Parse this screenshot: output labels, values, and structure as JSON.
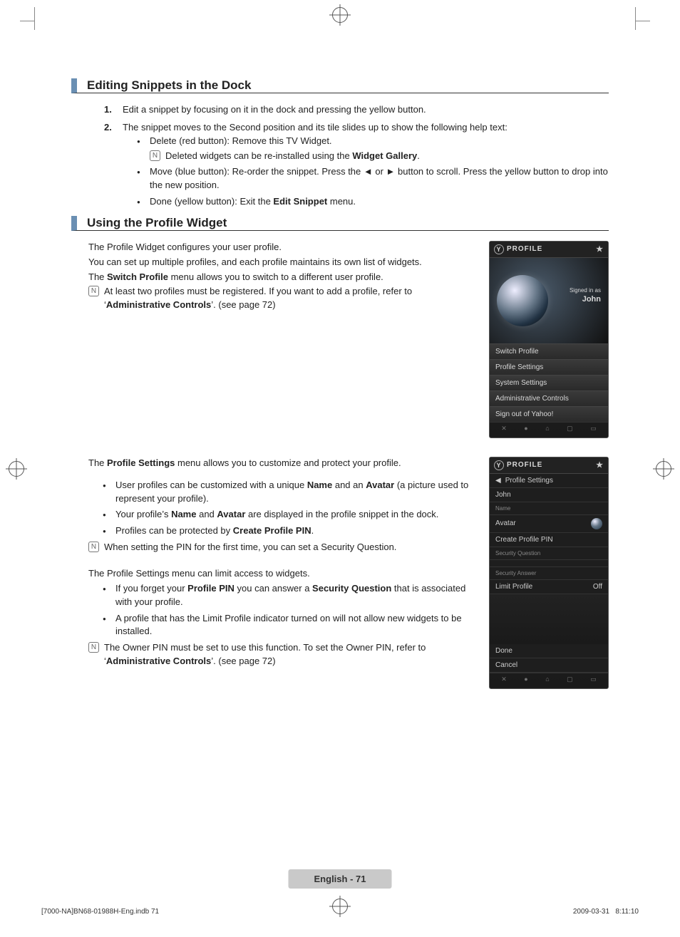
{
  "section1": {
    "title": "Editing Snippets in the Dock",
    "step1": "Edit a snippet by focusing on it in the dock and pressing the yellow button.",
    "step2": "The snippet moves to the Second position and its tile slides up to show the following help text:",
    "bullets": {
      "b1": "Delete (red button): Remove this TV Widget.",
      "b1_note_pre": "Deleted widgets can be re-installed using the ",
      "b1_note_bold": "Widget Gallery",
      "b1_note_post": ".",
      "b2": "Move (blue button): Re-order the snippet. Press the ◄ or ► button to scroll. Press the yellow button to drop into the new position.",
      "b3_pre": "Done (yellow button): Exit the ",
      "b3_bold": "Edit Snippet",
      "b3_post": " menu."
    }
  },
  "section2": {
    "title": "Using the Profile Widget",
    "p1": "The Profile Widget configures your user profile.",
    "p2": "You can set up multiple profiles, and each profile maintains its own list of widgets.",
    "p3_pre": "The ",
    "p3_bold": "Switch Profile",
    "p3_post": " menu allows you to switch to a different user profile.",
    "note_pre": "At least two profiles must be registered. If you want to add a profile, refer to ‘",
    "note_bold": "Administrative Controls",
    "note_post": "’. (see page 72)",
    "p4_pre": "The ",
    "p4_bold": "Profile Settings",
    "p4_post": " menu allows you to customize and protect your profile.",
    "s2b": {
      "b1_pre": "User profiles can be customized with a unique ",
      "b1_bold1": "Name",
      "b1_mid": " and an ",
      "b1_bold2": "Avatar",
      "b1_post": " (a picture used to represent your profile).",
      "b2_pre": "Your profile’s ",
      "b2_bold1": "Name",
      "b2_mid": " and ",
      "b2_bold2": "Avatar",
      "b2_post": " are displayed in the profile snippet in the dock.",
      "b3_pre": "Profiles can be protected by ",
      "b3_bold": "Create Profile PIN",
      "b3_post": ".",
      "note2": "When setting the PIN for the first time, you can set a Security Question."
    },
    "p5": "The Profile Settings menu can limit access to widgets.",
    "s2c": {
      "b1_pre": "If you forget your ",
      "b1_bold1": "Profile PIN",
      "b1_mid": " you can answer a ",
      "b1_bold2": "Security Question",
      "b1_post": " that is associated with your profile.",
      "b2": "A profile that has the Limit Profile indicator turned on will not allow new widgets to be installed.",
      "note3_pre": "The Owner PIN must be set to use this function. To set the Owner PIN, refer to ‘",
      "note3_bold": "Administrative Controls",
      "note3_post": "’. (see page 72)"
    }
  },
  "widget1": {
    "title": "PROFILE",
    "signed_label": "Signed in as",
    "signed_name": "John",
    "items": [
      "Switch Profile",
      "Profile Settings",
      "System Settings",
      "Administrative Controls",
      "Sign out of Yahoo!"
    ]
  },
  "widget2": {
    "title": "PROFILE",
    "back_label": "Profile Settings",
    "name_label": "John",
    "name_field": "Name",
    "avatar_label": "Avatar",
    "create_pin": "Create Profile PIN",
    "sec_q": "Security Question",
    "sec_a": "Security Answer",
    "limit_label": "Limit Profile",
    "limit_value": "Off",
    "done": "Done",
    "cancel": "Cancel"
  },
  "page_tag": "English - 71",
  "footer": {
    "left": "[7000-NA]BN68-01988H-Eng.indb   71",
    "date": "2009-03-31",
    "time": "   8:11:10"
  }
}
